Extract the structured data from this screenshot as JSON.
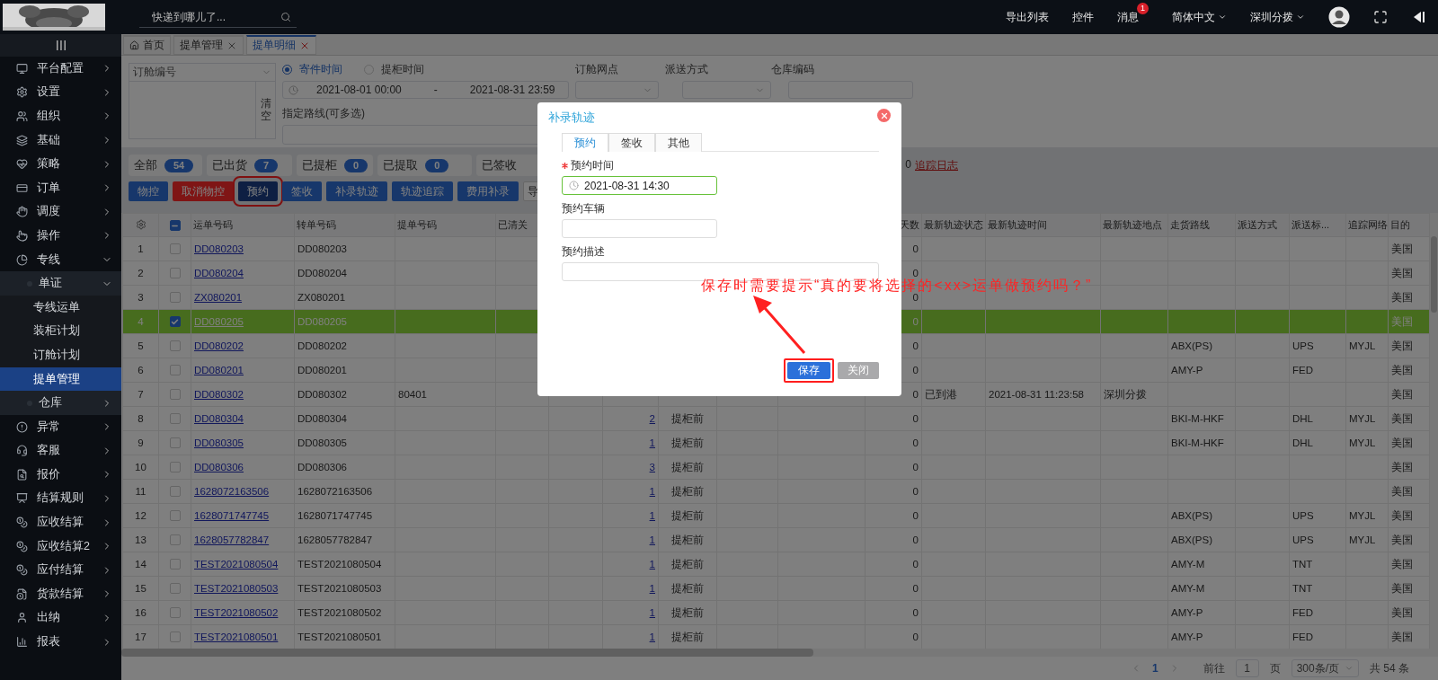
{
  "topbar": {
    "search": {
      "placeholder": "快递到哪儿了..."
    },
    "links": [
      {
        "label": "导出列表"
      },
      {
        "label": "控件"
      },
      {
        "label": "消息",
        "badge": "1"
      }
    ],
    "menus": [
      {
        "label": "简体中文"
      },
      {
        "label": "深圳分拨"
      }
    ]
  },
  "sidebar": {
    "items": [
      {
        "label": "平台配置",
        "selected": false,
        "expanded": false
      },
      {
        "label": "设置",
        "selected": false,
        "expanded": false
      },
      {
        "label": "组织",
        "selected": false,
        "expanded": false
      },
      {
        "label": "基础",
        "selected": false,
        "expanded": false
      },
      {
        "label": "策略",
        "selected": false,
        "expanded": false
      },
      {
        "label": "订单",
        "selected": false,
        "expanded": false
      },
      {
        "label": "调度",
        "selected": false,
        "expanded": false
      },
      {
        "label": "操作",
        "selected": false,
        "expanded": false
      },
      {
        "label": "专线",
        "selected": false,
        "expanded": true,
        "children": [
          {
            "label": "单证",
            "selected": false,
            "expanded": true,
            "children": [
              {
                "label": "专线运单",
                "selected": false
              },
              {
                "label": "装柜计划",
                "selected": false
              },
              {
                "label": "订舱计划",
                "selected": false
              },
              {
                "label": "提单管理",
                "selected": true
              }
            ]
          },
          {
            "label": "仓库",
            "selected": false,
            "expanded": false
          }
        ]
      },
      {
        "label": "异常",
        "selected": false,
        "expanded": false
      },
      {
        "label": "客服",
        "selected": false,
        "expanded": false
      },
      {
        "label": "报价",
        "selected": false,
        "expanded": false
      },
      {
        "label": "结算规则",
        "selected": false,
        "expanded": false
      },
      {
        "label": "应收结算",
        "selected": false,
        "expanded": false
      },
      {
        "label": "应收结算2",
        "selected": false,
        "expanded": false
      },
      {
        "label": "应付结算",
        "selected": false,
        "expanded": false
      },
      {
        "label": "货款结算",
        "selected": false,
        "expanded": false
      },
      {
        "label": "出纳",
        "selected": false,
        "expanded": false
      },
      {
        "label": "报表",
        "selected": false,
        "expanded": false
      }
    ]
  },
  "page_tabs": [
    {
      "label": "首页",
      "selected": false,
      "closable": false
    },
    {
      "label": "提单管理",
      "selected": false,
      "closable": true
    },
    {
      "label": "提单明细",
      "selected": true,
      "closable": true
    }
  ],
  "filters": {
    "number_type": "订舱编号",
    "clear_button": "清空",
    "date_types": [
      {
        "label": "寄件时间",
        "selected": true
      },
      {
        "label": "提柜时间",
        "selected": false
      }
    ],
    "date_start": "2021-08-01 00:00",
    "date_separator": "-",
    "date_end": "2021-08-31 23:59",
    "booking_point_label": "订舱网点",
    "delivery_method_label": "派送方式",
    "warehouse_code_label": "仓库编码",
    "route_label": "指定路线(可多选)"
  },
  "status_counts": [
    {
      "label": "全部",
      "count": "54"
    },
    {
      "label": "已出货",
      "count": "7"
    },
    {
      "label": "已提柜",
      "count": "0"
    },
    {
      "label": "已提取",
      "count": "0"
    },
    {
      "label": "已签收"
    }
  ],
  "status_trailing": "0",
  "log_link": "追踪日志",
  "actions": [
    {
      "label": "物控",
      "kind": "primary",
      "highlighted": false
    },
    {
      "label": "取消物控",
      "kind": "danger",
      "highlighted": false
    },
    {
      "label": "预约",
      "kind": "dark",
      "highlighted": true
    },
    {
      "label": "签收",
      "kind": "primary",
      "highlighted": false
    },
    {
      "label": "补录轨迹",
      "kind": "primary",
      "highlighted": false
    },
    {
      "label": "轨迹追踪",
      "kind": "primary",
      "highlighted": false
    },
    {
      "label": "费用补录",
      "kind": "primary",
      "highlighted": false
    },
    {
      "label": "导",
      "kind": "plain",
      "highlighted": false
    }
  ],
  "table": {
    "select_all_partial": true,
    "columns": {
      "waybill": "运单号码",
      "transfer": "转单号码",
      "bill": "提单号码",
      "cleared": "已清关",
      "days": "天数",
      "track_status": "最新轨迹状态",
      "track_time": "最新轨迹时间",
      "track_place": "最新轨迹地点",
      "route": "走货路线",
      "delivery": "派送方式",
      "delivery_mark": "派送标...",
      "network": "追踪网络",
      "destination": "目的"
    },
    "rows": [
      {
        "no": "1",
        "selected": false,
        "waybill": "DD080203",
        "transfer": "DD080203",
        "days": "0",
        "destination": "美国"
      },
      {
        "no": "2",
        "selected": false,
        "waybill": "DD080204",
        "transfer": "DD080204",
        "days": "0",
        "destination": "美国"
      },
      {
        "no": "3",
        "selected": false,
        "waybill": "ZX080201",
        "transfer": "ZX080201",
        "days": "0",
        "destination": "美国"
      },
      {
        "no": "4",
        "selected": true,
        "waybill": "DD080205",
        "transfer": "DD080205",
        "days": "0",
        "destination": "美国"
      },
      {
        "no": "5",
        "selected": false,
        "waybill": "DD080202",
        "transfer": "DD080202",
        "days": "0",
        "route": "ABX(PS)",
        "delivery_mark": "UPS",
        "network": "MYJL",
        "destination": "美国"
      },
      {
        "no": "6",
        "selected": false,
        "waybill": "DD080201",
        "transfer": "DD080201",
        "days": "0",
        "route": "AMY-P",
        "delivery_mark": "FED",
        "destination": "美国"
      },
      {
        "no": "7",
        "selected": false,
        "waybill": "DD080302",
        "transfer": "DD080302",
        "bill": "80401",
        "days": "0",
        "track_status": "已到港",
        "track_time": "2021-08-31 11:23:58",
        "track_place": "深圳分拨",
        "destination": "美国"
      },
      {
        "no": "8",
        "selected": false,
        "waybill": "DD080304",
        "transfer": "DD080304",
        "column_8": "2",
        "column_9": "提柜前",
        "days": "0",
        "route": "BKI-M-HKF",
        "delivery_mark": "DHL",
        "network": "MYJL",
        "destination": "美国"
      },
      {
        "no": "9",
        "selected": false,
        "waybill": "DD080305",
        "transfer": "DD080305",
        "column_8": "1",
        "column_9": "提柜前",
        "days": "0",
        "route": "BKI-M-HKF",
        "delivery_mark": "DHL",
        "network": "MYJL",
        "destination": "美国"
      },
      {
        "no": "10",
        "selected": false,
        "waybill": "DD080306",
        "transfer": "DD080306",
        "column_8": "3",
        "column_9": "提柜前",
        "days": "0",
        "destination": "美国"
      },
      {
        "no": "11",
        "selected": false,
        "waybill": "1628072163506",
        "transfer": "1628072163506",
        "column_8": "1",
        "column_9": "提柜前",
        "days": "0",
        "destination": "美国"
      },
      {
        "no": "12",
        "selected": false,
        "waybill": "1628071747745",
        "transfer": "1628071747745",
        "column_8": "1",
        "column_9": "提柜前",
        "days": "0",
        "route": "ABX(PS)",
        "delivery_mark": "UPS",
        "network": "MYJL",
        "destination": "美国"
      },
      {
        "no": "13",
        "selected": false,
        "waybill": "1628057782847",
        "transfer": "1628057782847",
        "column_8": "1",
        "column_9": "提柜前",
        "days": "0",
        "route": "ABX(PS)",
        "delivery_mark": "UPS",
        "network": "MYJL",
        "destination": "美国"
      },
      {
        "no": "14",
        "selected": false,
        "waybill": "TEST2021080504",
        "transfer": "TEST2021080504",
        "column_8": "1",
        "column_9": "提柜前",
        "days": "0",
        "route": "AMY-M",
        "delivery_mark": "TNT",
        "destination": "美国"
      },
      {
        "no": "15",
        "selected": false,
        "waybill": "TEST2021080503",
        "transfer": "TEST2021080503",
        "column_8": "1",
        "column_9": "提柜前",
        "days": "0",
        "route": "AMY-M",
        "delivery_mark": "TNT",
        "destination": "美国"
      },
      {
        "no": "16",
        "selected": false,
        "waybill": "TEST2021080502",
        "transfer": "TEST2021080502",
        "column_8": "1",
        "column_9": "提柜前",
        "days": "0",
        "route": "AMY-P",
        "delivery_mark": "FED",
        "destination": "美国"
      },
      {
        "no": "17",
        "selected": false,
        "waybill": "TEST2021080501",
        "transfer": "TEST2021080501",
        "column_8": "1",
        "column_9": "提柜前",
        "days": "0",
        "route": "AMY-P",
        "delivery_mark": "FED",
        "destination": "美国"
      }
    ]
  },
  "pagination": {
    "current_page": "1",
    "goto_label": "前往",
    "goto_value": "1",
    "page_unit": "页",
    "page_size": "300条/页",
    "total": "共 54 条"
  },
  "dialog": {
    "title": "补录轨迹",
    "tabs": [
      {
        "label": "预约",
        "selected": true
      },
      {
        "label": "签收",
        "selected": false
      },
      {
        "label": "其他",
        "selected": false
      }
    ],
    "fields": [
      {
        "label": "预约时间",
        "required": true,
        "valid": true,
        "kind": "time",
        "value": "2021-08-31 14:30"
      },
      {
        "label": "预约车辆",
        "required": false,
        "valid": false,
        "kind": "text"
      },
      {
        "label": "预约描述",
        "required": false,
        "valid": false,
        "kind": "wide"
      }
    ],
    "buttons": [
      {
        "label": "保存",
        "kind": "primary",
        "highlighted": true
      },
      {
        "label": "关闭",
        "kind": "secondary",
        "highlighted": false
      }
    ]
  },
  "annotation": "保存时需要提示“真的要将选择的<xx>运单做预约吗？”"
}
